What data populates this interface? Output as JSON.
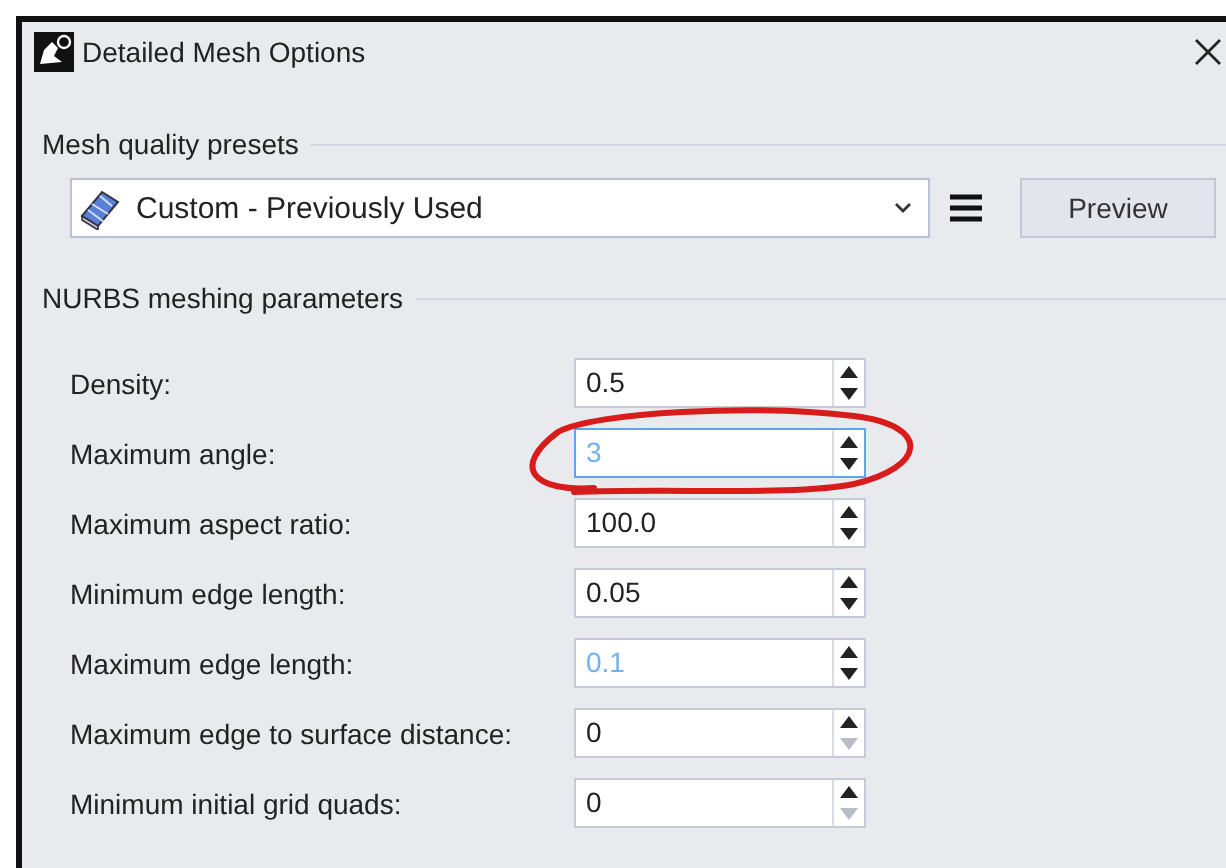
{
  "window": {
    "title": "Detailed Mesh Options"
  },
  "presets": {
    "title": "Mesh quality presets",
    "selected_preset": "Custom - Previously Used",
    "preview_button": "Preview"
  },
  "nurbs": {
    "title": "NURBS meshing parameters",
    "rows": [
      {
        "label": "Density:",
        "value": "0.5",
        "focused": false,
        "highlighted": false,
        "down_disabled": false
      },
      {
        "label": "Maximum angle:",
        "value": "3",
        "focused": true,
        "highlighted": true,
        "down_disabled": false,
        "annotated": true
      },
      {
        "label": "Maximum aspect ratio:",
        "value": "100.0",
        "focused": false,
        "highlighted": false,
        "down_disabled": false
      },
      {
        "label": "Minimum edge length:",
        "value": "0.05",
        "focused": false,
        "highlighted": false,
        "down_disabled": false
      },
      {
        "label": "Maximum edge length:",
        "value": "0.1",
        "focused": false,
        "highlighted": true,
        "down_disabled": false
      },
      {
        "label": "Maximum edge to surface distance:",
        "value": "0",
        "focused": false,
        "highlighted": false,
        "down_disabled": true
      },
      {
        "label": "Minimum initial grid quads:",
        "value": "0",
        "focused": false,
        "highlighted": false,
        "down_disabled": true
      }
    ]
  }
}
